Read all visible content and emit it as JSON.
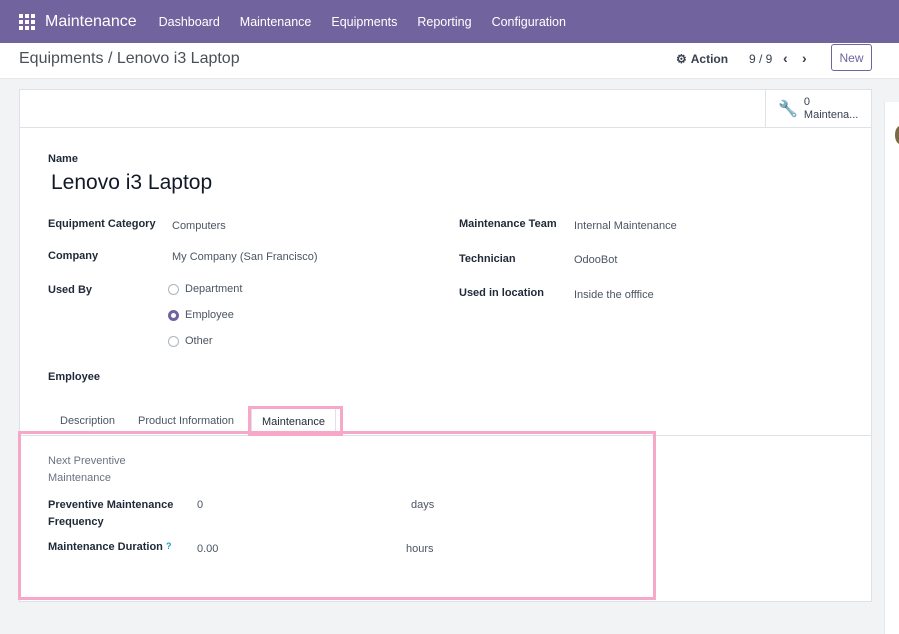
{
  "topbar": {
    "brand": "Maintenance",
    "menu": [
      "Dashboard",
      "Maintenance",
      "Equipments",
      "Reporting",
      "Configuration"
    ]
  },
  "control": {
    "breadcrumb": "Equipments / Lenovo i3 Laptop",
    "action_label": "Action",
    "pager": "9 / 9",
    "new_label": "New"
  },
  "stat_button": {
    "count": "0",
    "label": "Maintena..."
  },
  "form": {
    "name_label": "Name",
    "name_value": "Lenovo i3 Laptop",
    "equipment_category_label": "Equipment Category",
    "equipment_category_value": "Computers",
    "company_label": "Company",
    "company_value": "My Company (San Francisco)",
    "used_by_label": "Used By",
    "used_by_options": [
      "Department",
      "Employee",
      "Other"
    ],
    "used_by_selected": "Employee",
    "employee_label": "Employee",
    "maintenance_team_label": "Maintenance Team",
    "maintenance_team_value": "Internal Maintenance",
    "technician_label": "Technician",
    "technician_value": "OdooBot",
    "used_in_location_label": "Used in location",
    "used_in_location_value": "Inside the offfice"
  },
  "tabs": [
    "Description",
    "Product Information",
    "Maintenance"
  ],
  "active_tab": "Maintenance",
  "maintenance_tab": {
    "next_preventive_label": "Next Preventive Maintenance",
    "frequency_label": "Preventive Maintenance Frequency",
    "frequency_value": "0",
    "frequency_unit": "days",
    "duration_label": "Maintenance Duration",
    "duration_help": "?",
    "duration_value": "0.00",
    "duration_unit": "hours"
  },
  "colors": {
    "brand": "#71639e",
    "highlight": "#f7a8c8"
  }
}
